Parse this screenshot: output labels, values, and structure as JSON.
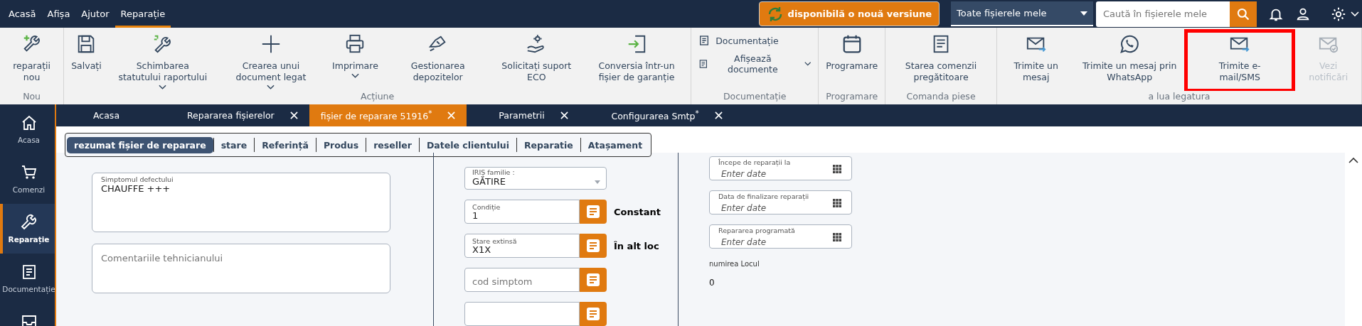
{
  "top_menu": [
    {
      "label": "Acasă",
      "selected": false
    },
    {
      "label": "Afișa",
      "selected": false
    },
    {
      "label": "Ajutor",
      "selected": false
    },
    {
      "label": "Reparație",
      "selected": true
    }
  ],
  "update_button": "disponibilă o nouă versiune",
  "file_filter": "Toate fișierele mele",
  "search": {
    "placeholder": "Caută în fișierele mele"
  },
  "ribbon": [
    {
      "label": "Nou",
      "items": [
        {
          "label": "reparații nou",
          "dropdown": false,
          "disabled": false,
          "highlighted": false
        }
      ]
    },
    {
      "label": "Acțiune",
      "items": [
        {
          "label": "Salvați",
          "dropdown": false,
          "disabled": false,
          "highlighted": false
        },
        {
          "label": "Schimbarea statutului raportului",
          "dropdown": true,
          "disabled": false,
          "highlighted": false
        },
        {
          "label": "Crearea unui document legat",
          "dropdown": true,
          "disabled": false,
          "highlighted": false
        },
        {
          "label": "Imprimare",
          "dropdown": true,
          "disabled": false,
          "highlighted": false
        },
        {
          "label": "Gestionarea depozitelor",
          "dropdown": false,
          "disabled": false,
          "highlighted": false
        },
        {
          "label": "Solicitați suport ECO",
          "dropdown": false,
          "disabled": false,
          "highlighted": false
        },
        {
          "label": "Conversia într-un fișier de garanție",
          "dropdown": false,
          "disabled": false,
          "highlighted": false
        }
      ]
    },
    {
      "label": "Documentație",
      "kind": "list",
      "items": [
        {
          "label": "Documentație",
          "dropdown": false
        },
        {
          "label": "Afișează documente",
          "dropdown": true
        }
      ]
    },
    {
      "label": "Programare",
      "items": [
        {
          "label": "Programare",
          "dropdown": false,
          "disabled": false,
          "highlighted": false
        }
      ]
    },
    {
      "label": "Comanda piese",
      "items": [
        {
          "label": "Starea comenzii pregătitoare",
          "dropdown": false,
          "disabled": false,
          "highlighted": false
        }
      ]
    },
    {
      "label": "a lua legatura",
      "items": [
        {
          "label": "Trimite un mesaj",
          "dropdown": false,
          "disabled": false,
          "highlighted": false
        },
        {
          "label": "Trimite un mesaj prin WhatsApp",
          "dropdown": false,
          "disabled": false,
          "highlighted": false
        },
        {
          "label": "Trimite e-mail/SMS",
          "dropdown": false,
          "disabled": false,
          "highlighted": true
        },
        {
          "label": "Vezi notificări",
          "dropdown": false,
          "disabled": true,
          "highlighted": false
        }
      ]
    }
  ],
  "sidebar": [
    {
      "label": "Acasa",
      "selected": false
    },
    {
      "label": "Comenzi",
      "selected": false
    },
    {
      "label": "Reparație",
      "selected": true
    },
    {
      "label": "Documentație",
      "selected": false
    },
    {
      "selected": false
    }
  ],
  "tabs": [
    {
      "label": "Acasa",
      "closable": false,
      "selected": false
    },
    {
      "label": "Repararea fișierelor",
      "closable": true,
      "selected": false
    },
    {
      "label": "fișier de reparare 51916$^{*}$",
      "closable": true,
      "selected": true
    },
    {
      "label": "Parametrii",
      "closable": true,
      "selected": false
    },
    {
      "label": "Configurarea Smtp$^{*}$",
      "closable": true,
      "selected": false
    }
  ],
  "subtabs": [
    {
      "label": "rezumat fișier de reparare",
      "selected": true
    },
    {
      "label": "stare",
      "selected": false
    },
    {
      "label": "Referință",
      "selected": false
    },
    {
      "label": "Produs",
      "selected": false
    },
    {
      "label": "reseller",
      "selected": false
    },
    {
      "label": "Datele clientului",
      "selected": false
    },
    {
      "label": "Reparatie",
      "selected": false
    },
    {
      "label": "Atașament",
      "selected": false
    }
  ],
  "symptom": {
    "label": "Simptomul defectului",
    "value": "CHAUFFE +++"
  },
  "technician_comments": {
    "placeholder": "Comentariile tehnicianului"
  },
  "iris_family": {
    "label": "IRIȘ familie :",
    "value": "GĂTIRE"
  },
  "code_fields": [
    {
      "kind": "filled",
      "label": "Condiție",
      "value": "1",
      "note": "Constant"
    },
    {
      "kind": "filled",
      "label": "Stare extinsă",
      "value": "X1X",
      "note": "În alt loc"
    },
    {
      "kind": "placeholder",
      "placeholder": "cod simptom"
    },
    {
      "kind": "blank"
    }
  ],
  "date_fields": [
    {
      "label": "Începe de reparații la",
      "placeholder": "Enter date"
    },
    {
      "label": "Data de finalizare reparații",
      "placeholder": "Enter date"
    },
    {
      "label": "Repararea programată",
      "placeholder": "Enter date"
    }
  ],
  "location": {
    "label": "numirea Locul",
    "value": "0"
  }
}
